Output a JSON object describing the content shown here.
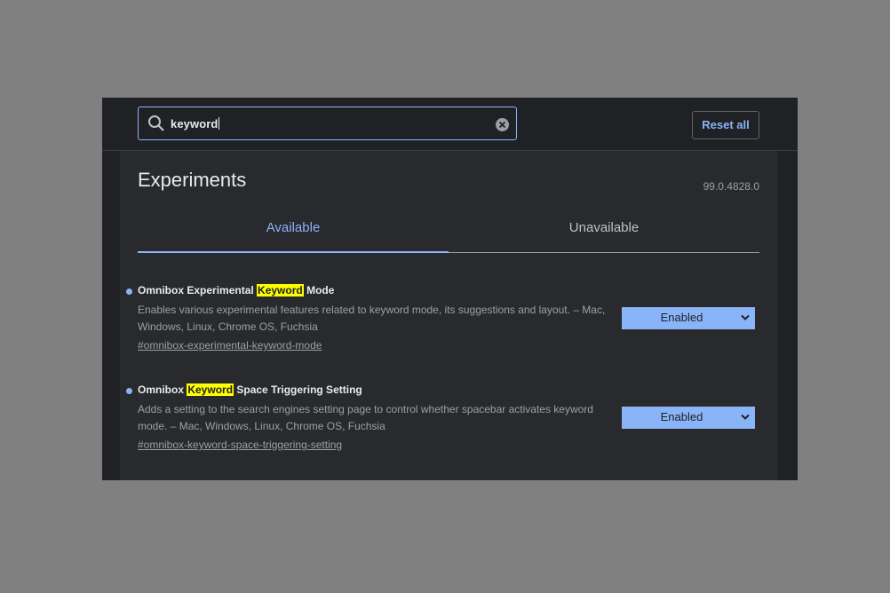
{
  "search": {
    "value": "keyword"
  },
  "header": {
    "reset_label": "Reset all"
  },
  "page": {
    "title": "Experiments",
    "version": "99.0.4828.0"
  },
  "tabs": [
    {
      "label": "Available",
      "active": true
    },
    {
      "label": "Unavailable",
      "active": false
    }
  ],
  "experiments": [
    {
      "title_pre": "Omnibox Experimental ",
      "title_hl": "Keyword",
      "title_post": " Mode",
      "desc": "Enables various experimental features related to keyword mode, its suggestions and layout. – Mac, Windows, Linux, Chrome OS, Fuchsia",
      "link": "#omnibox-experimental-keyword-mode",
      "state": "Enabled"
    },
    {
      "title_pre": "Omnibox ",
      "title_hl": "Keyword",
      "title_post": " Space Triggering Setting",
      "desc": "Adds a setting to the search engines setting page to control whether spacebar activates keyword mode. – Mac, Windows, Linux, Chrome OS, Fuchsia",
      "link": "#omnibox-keyword-space-triggering-setting",
      "state": "Enabled"
    }
  ],
  "colors": {
    "accent": "#8ab4f8",
    "highlight": "#ffff00",
    "background": "#202124",
    "panel": "#292a2d"
  }
}
